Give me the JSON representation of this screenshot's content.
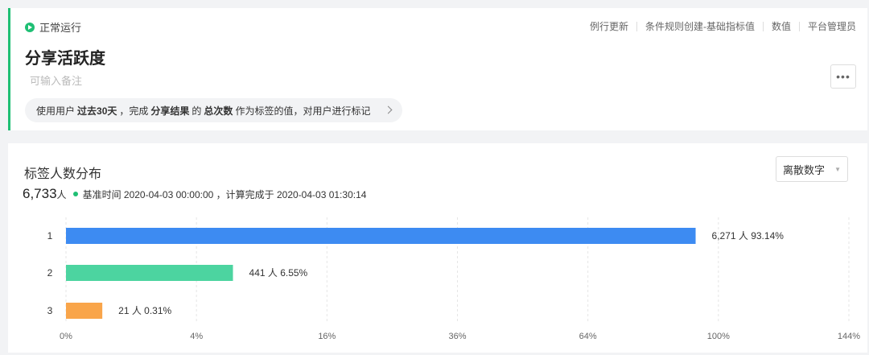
{
  "header": {
    "status_label": "正常运行",
    "meta": [
      "例行更新",
      "条件规则创建-基础指标值",
      "数值",
      "平台管理员"
    ],
    "title": "分享活跃度",
    "note_placeholder": "可输入备注",
    "more_label": "•••",
    "rule": {
      "p1": "使用用户",
      "b1": "过去30天",
      "p2": "，完成",
      "b2": "分享结果",
      "p3": "的",
      "b3": "总次数",
      "p4": "作为标签的值，对用户进行标记"
    }
  },
  "distribution": {
    "title": "标签人数分布",
    "select_value": "离散数字",
    "total": "6,733",
    "total_unit": "人",
    "info": "基准时间 2020-04-03 00:00:00 ，计算完成于 2020-04-03 01:30:14"
  },
  "colors": {
    "accent": "#1fbf74",
    "bar1": "#3d8bf2",
    "bar2": "#4cd4a0",
    "bar3": "#f9a54a"
  },
  "chart_data": {
    "type": "bar",
    "orientation": "horizontal",
    "categories": [
      "1",
      "2",
      "3"
    ],
    "values": [
      6271,
      441,
      21
    ],
    "percents": [
      93.14,
      6.55,
      0.31
    ],
    "data_labels": [
      "6,271 人 93.14%",
      "441 人 6.55%",
      "21 人 0.31%"
    ],
    "x_ticks": [
      "0%",
      "4%",
      "16%",
      "36%",
      "64%",
      "100%",
      "144%"
    ],
    "x_scale": "sqrt",
    "x_max_percent": 144,
    "grid": true
  }
}
